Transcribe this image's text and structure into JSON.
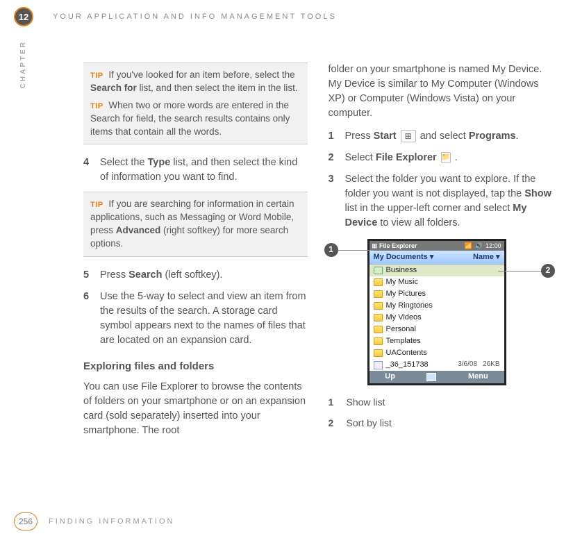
{
  "header": {
    "chapter_number": "12",
    "title": "YOUR APPLICATION AND INFO MANAGEMENT TOOLS",
    "vertical_label": "CHAPTER"
  },
  "left_col": {
    "tipbox1": {
      "tip_label": "TIP",
      "tip1_a": "If you've looked for an item before, select the ",
      "tip1_b": "Search for",
      "tip1_c": " list, and then select the item in the list.",
      "tip2": "When two or more words are entered in the Search for field, the search results contains only items that contain all the words."
    },
    "step4": {
      "num": "4",
      "a": "Select the ",
      "b": "Type",
      "c": " list, and then select the kind of information you want to find."
    },
    "tipbox2": {
      "tip_label": "TIP",
      "a": "If you are searching for information in certain applications, such as Messaging or Word Mobile, press ",
      "b": "Advanced",
      "c": " (right softkey) for more search options."
    },
    "step5": {
      "num": "5",
      "a": "Press ",
      "b": "Search",
      "c": " (left softkey)."
    },
    "step6": {
      "num": "6",
      "text": "Use the 5-way to select and view an item from the results of the search. A storage card symbol appears next to the names of files that are located on an expansion card."
    },
    "section_head": "Exploring files and folders",
    "para": "You can use File Explorer to browse the contents of folders on your smartphone or on an expansion card (sold separately) inserted into your smartphone. The root"
  },
  "right_col": {
    "para1": "folder on your smartphone is named My Device. My Device is similar to My Computer (Windows XP) or Computer (Windows Vista) on your computer.",
    "step1": {
      "num": "1",
      "a": "Press ",
      "b": "Start",
      "c": " and select ",
      "d": "Programs",
      "e": "."
    },
    "step2": {
      "num": "2",
      "a": "Select ",
      "b": "File Explorer",
      "c": " ."
    },
    "step3": {
      "num": "3",
      "a": "Select the folder you want to explore. If the folder you want is not displayed, tap the ",
      "b": "Show",
      "c": " list in the upper-left corner and select ",
      "d": "My Device",
      "e": " to view all folders."
    },
    "callout1": "1",
    "callout2": "2",
    "legend1": {
      "num": "1",
      "text": "Show list"
    },
    "legend2": {
      "num": "2",
      "text": "Sort by list"
    }
  },
  "phone": {
    "title_left": "File Explorer",
    "signal": "📶",
    "vol": "🔊",
    "time": "12:00",
    "bar_left": "My Documents ▾",
    "bar_right": "Name ▾",
    "rows": [
      {
        "name": "Business",
        "selected": true
      },
      {
        "name": "My Music"
      },
      {
        "name": "My Pictures"
      },
      {
        "name": "My Ringtones"
      },
      {
        "name": "My Videos"
      },
      {
        "name": "Personal"
      },
      {
        "name": "Templates"
      },
      {
        "name": "UAContents"
      },
      {
        "name": "_36_151738",
        "file": true,
        "date": "3/6/08",
        "size": "26KB"
      }
    ],
    "bottom_left": "Up",
    "bottom_right": "Menu"
  },
  "footer": {
    "page": "256",
    "title": "FINDING INFORMATION"
  }
}
